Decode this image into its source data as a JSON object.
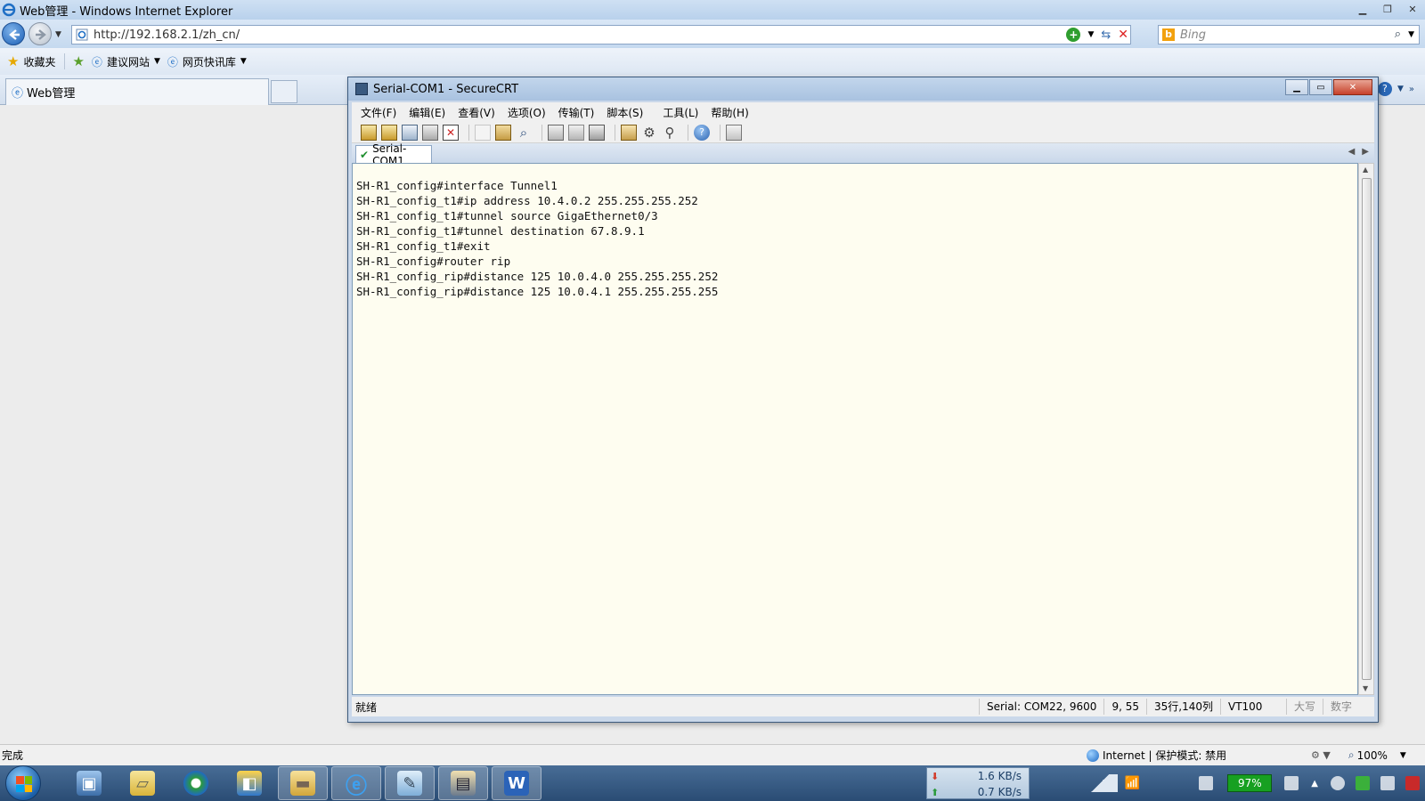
{
  "ie": {
    "window_title": "Web管理 - Windows Internet Explorer",
    "url": "http://192.168.2.1/zh_cn/",
    "search_placeholder": "Bing",
    "favorites": {
      "label": "收藏夹",
      "items": [
        "建议网站",
        "网页快讯库"
      ]
    },
    "tab_label": "Web管理",
    "status_done": "完成",
    "status_zone": "Internet | 保护模式: 禁用",
    "zoom": "100%"
  },
  "crt": {
    "title": "Serial-COM1 - SecureCRT",
    "menu": [
      "文件(F)",
      "编辑(E)",
      "查看(V)",
      "选项(O)",
      "传输(T)",
      "脚本(S)",
      "工具(L)",
      "帮助(H)"
    ],
    "session_tab": "Serial-COM1",
    "terminal_lines": [
      "SH-R1_config#interface Tunnel1",
      "SH-R1_config_t1#ip address 10.4.0.2 255.255.255.252",
      "SH-R1_config_t1#tunnel source GigaEthernet0/3",
      "SH-R1_config_t1#tunnel destination 67.8.9.1",
      "SH-R1_config_t1#exit",
      "SH-R1_config#router rip",
      "SH-R1_config_rip#distance 125 10.0.4.0 255.255.255.252",
      "SH-R1_config_rip#distance 125 10.0.4.1 255.255.255.255"
    ],
    "status": {
      "ready": "就绪",
      "serial": "Serial: COM22, 9600",
      "cursor": "9, 55",
      "size": "35行,140列",
      "term_type": "VT100",
      "caps": "大写",
      "num": "数字"
    }
  },
  "taskbar": {
    "download_speed": "1.6 KB/s",
    "upload_speed": "0.7 KB/s",
    "battery": "97%"
  }
}
